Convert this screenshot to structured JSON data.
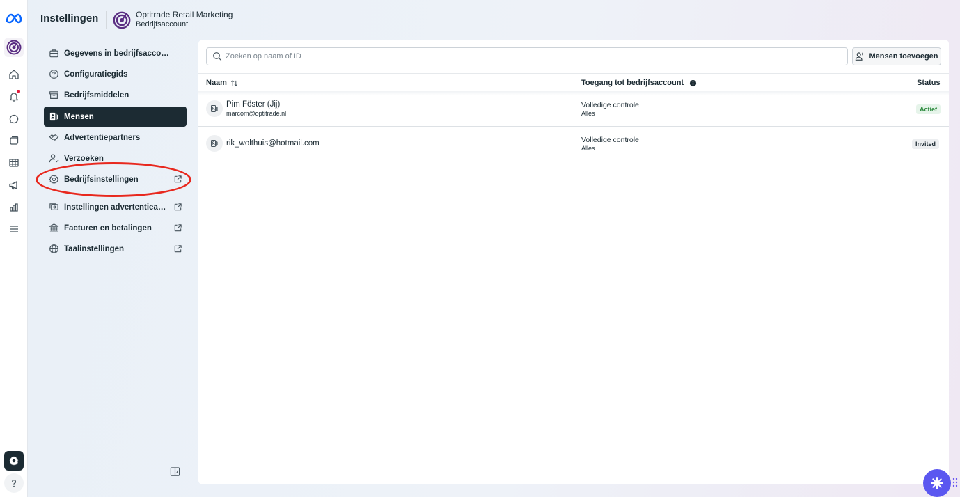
{
  "header": {
    "title": "Instellingen",
    "account_name": "Optitrade Retail Marketing",
    "account_type": "Bedrijfsaccount"
  },
  "rail": {
    "items": [
      "meta-logo-icon",
      "account-avatar-icon",
      "home-icon",
      "bell-icon",
      "chat-bubble-icon",
      "stacked-pages-icon",
      "table-icon",
      "megaphone-icon",
      "bar-chart-icon",
      "menu-lines-icon",
      "gear-icon",
      "help-icon"
    ],
    "notification_color": "#e41e3f"
  },
  "nav": {
    "items": [
      {
        "label": "Gegevens in bedrijfsaccount",
        "icon": "briefcase-icon",
        "external": false
      },
      {
        "label": "Configuratiegids",
        "icon": "question-circle-icon",
        "external": false
      },
      {
        "label": "Bedrijfsmiddelen",
        "icon": "archive-box-icon",
        "external": false
      },
      {
        "label": "Mensen",
        "icon": "people-icon",
        "external": false,
        "active": true
      },
      {
        "label": "Advertentiepartners",
        "icon": "handshake-icon",
        "external": false
      },
      {
        "label": "Verzoeken",
        "icon": "person-request-icon",
        "external": false
      },
      {
        "label": "Bedrijfsinstellingen",
        "icon": "gear-icon",
        "external": true
      },
      {
        "label": "Instellingen advertentieaccount",
        "icon": "ad-account-icon",
        "external": true
      },
      {
        "label": "Facturen en betalingen",
        "icon": "bank-icon",
        "external": true
      },
      {
        "label": "Taalinstellingen",
        "icon": "globe-icon",
        "external": true
      }
    ],
    "active_color": "#1c2b33",
    "annotation_color": "#e8281e"
  },
  "main": {
    "search_placeholder": "Zoeken op naam of ID",
    "add_button": "Mensen toevoegen",
    "columns": {
      "name": "Naam",
      "access": "Toegang tot bedrijfsaccount",
      "status": "Status"
    },
    "rows": [
      {
        "name": "Pim Föster (Jij)",
        "email": "marcom@optitrade.nl",
        "access": "Volledige controle",
        "scope": "Alles",
        "status": "Actief"
      },
      {
        "name": "rik_wolthuis@hotmail.com",
        "email": "",
        "access": "Volledige controle",
        "scope": "Alles",
        "status": "Invited"
      }
    ],
    "status_colors": {
      "actief": "#2d8a3e",
      "invited": "#1c2b33"
    }
  },
  "assistant": {
    "icon": "sparkle-icon",
    "color": "#5b57f0"
  }
}
